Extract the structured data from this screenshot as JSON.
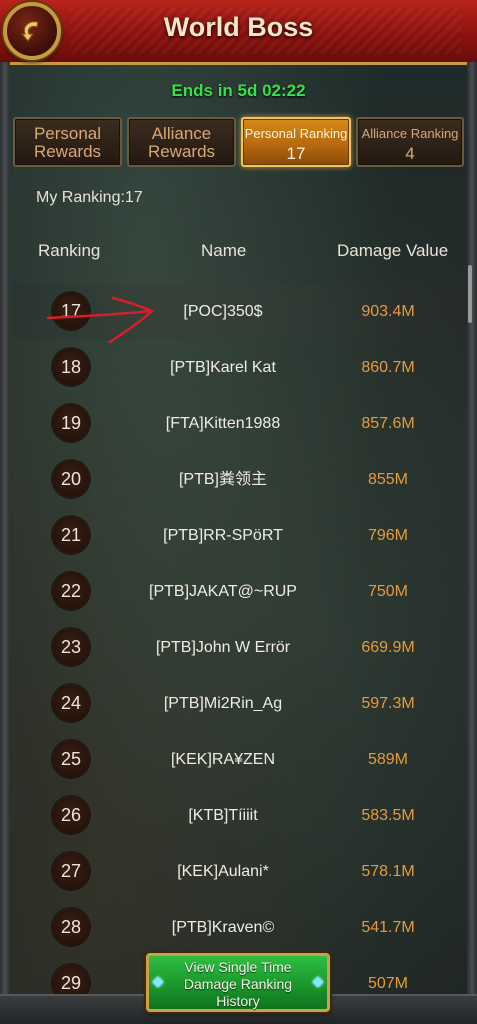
{
  "header": {
    "title": "World Boss",
    "back_icon": "back-arrow-icon"
  },
  "timer": {
    "ends_text": "Ends in 5d 02:22"
  },
  "tabs": [
    {
      "line1": "Personal",
      "line2": "Rewards"
    },
    {
      "line1": "Alliance",
      "line2": "Rewards"
    },
    {
      "line1": "Personal Ranking",
      "line2": "17"
    },
    {
      "line1": "Alliance Ranking",
      "line2": "4"
    }
  ],
  "my_ranking": "My Ranking:17",
  "columns": {
    "rank": "Ranking",
    "name": "Name",
    "damage": "Damage Value"
  },
  "rows": [
    {
      "rank": "17",
      "name": "[POC]350$",
      "damage": "903.4M"
    },
    {
      "rank": "18",
      "name": "[PTB]Karel Kat",
      "damage": "860.7M"
    },
    {
      "rank": "19",
      "name": "[FTA]Kitten1988",
      "damage": "857.6M"
    },
    {
      "rank": "20",
      "name": "[PTB]粪领主",
      "damage": "855M"
    },
    {
      "rank": "21",
      "name": "[PTB]RR-SPöRT",
      "damage": "796M"
    },
    {
      "rank": "22",
      "name": "[PTB]JAKAT@~RUP",
      "damage": "750M"
    },
    {
      "rank": "23",
      "name": "[PTB]John W Errör",
      "damage": "669.9M"
    },
    {
      "rank": "24",
      "name": "[PTB]Mi2Rin_Ag",
      "damage": "597.3M"
    },
    {
      "rank": "25",
      "name": "[KEK]RA¥ZEN",
      "damage": "589M"
    },
    {
      "rank": "26",
      "name": "[KTB]Tíiiit",
      "damage": "583.5M"
    },
    {
      "rank": "27",
      "name": "[KEK]Aulani*",
      "damage": "578.1M"
    },
    {
      "rank": "28",
      "name": "[PTB]Kraven©",
      "damage": "541.7M"
    },
    {
      "rank": "29",
      "name": "",
      "damage": "507M"
    }
  ],
  "history_button": {
    "line1": "View Single Time",
    "line2": "Damage Ranking",
    "line3": "History"
  },
  "colors": {
    "accent": "#e69a3c",
    "timer": "#39e04a",
    "header": "#8e130f",
    "annotation": "#d4202a"
  }
}
